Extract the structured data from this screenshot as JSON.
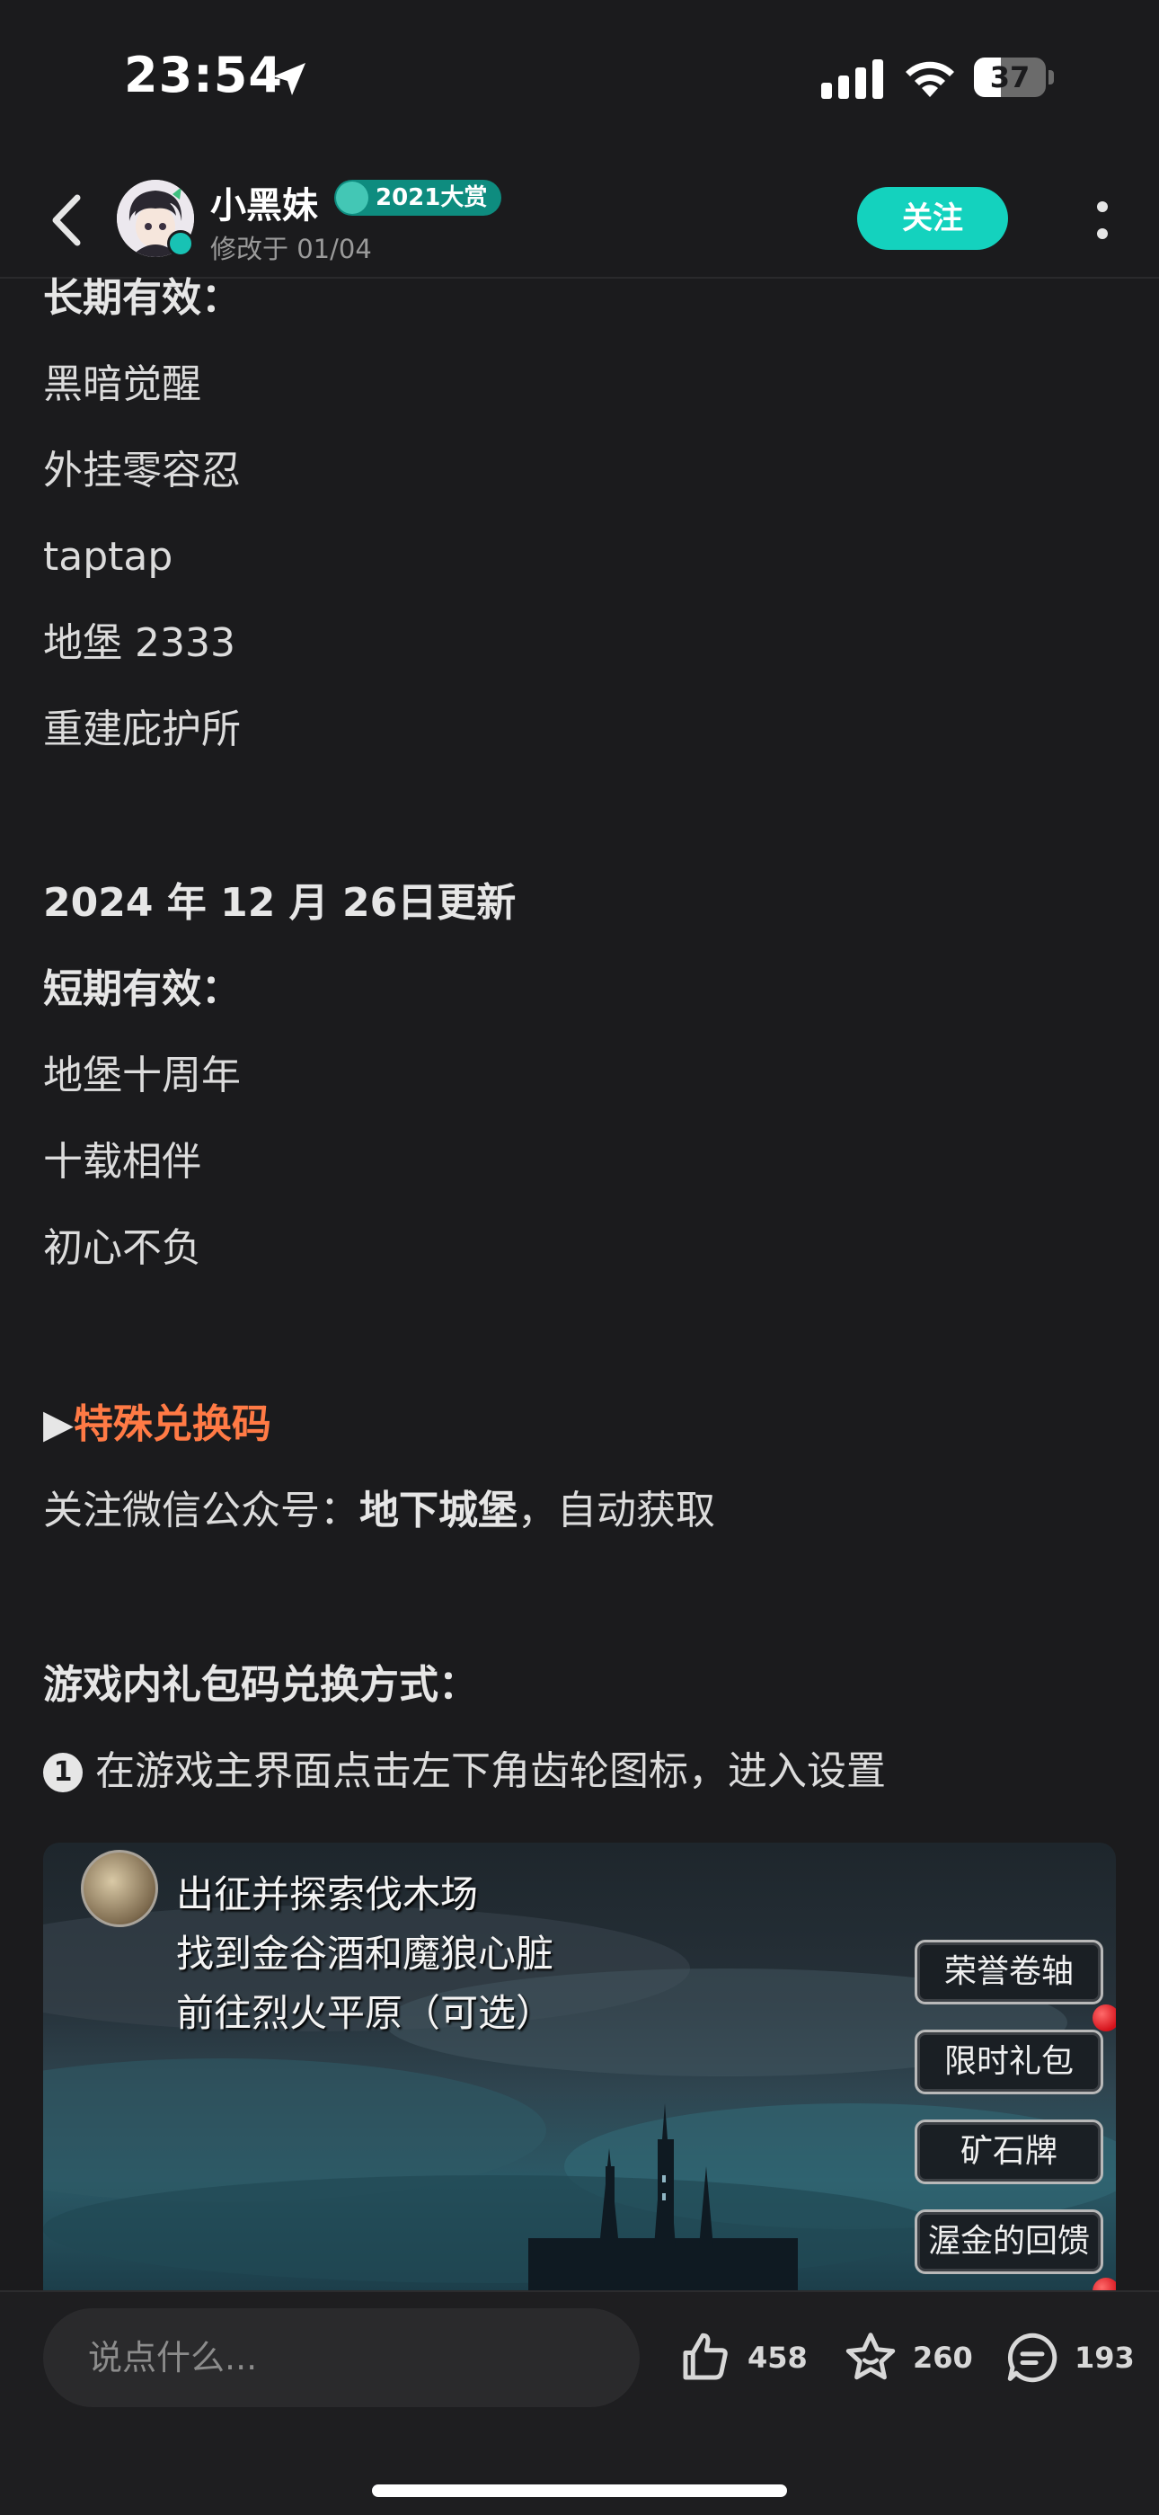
{
  "status_bar": {
    "time": "23:54",
    "battery": "37",
    "battery_level": 0.37,
    "icons": [
      "location-arrow-icon",
      "cellular-signal-icon",
      "wifi-icon",
      "battery-icon"
    ]
  },
  "header": {
    "username": "小黑妹",
    "award": "2021大赏",
    "modified": "修改于 01/04",
    "follow_label": "关注",
    "accent": "#14d2be"
  },
  "content": {
    "lines": {
      "long_term_heading": "长期有效：",
      "code_1": "黑暗觉醒",
      "code_2": "外挂零容忍",
      "code_3": "taptap",
      "code_4": "地堡 2333",
      "code_5": "重建庇护所",
      "update_date": "2024 年 12 月 26日更新",
      "short_term_heading": "短期有效：",
      "short_1": "地堡十周年",
      "short_2": "十载相伴",
      "short_3": "初心不负",
      "special_arrow": "▶",
      "special_title": "特殊兑换码",
      "wechat_prefix": "关注微信公众号：",
      "wechat_name": "地下城堡",
      "wechat_suffix": "，自动获取",
      "redeem_heading": "游戏内礼包码兑换方式：",
      "step_number": "1",
      "step_1": "在游戏主界面点击左下角齿轮图标，进入设置"
    },
    "special_color": "#ff7a45"
  },
  "game_image": {
    "quests": [
      "出征并探索伐木场",
      "找到金谷酒和魔狼心脏",
      "前往烈火平原（可选）"
    ],
    "buttons": [
      "荣誉卷轴",
      "限时礼包",
      "矿石牌",
      "渥金的回馈"
    ]
  },
  "bottom_bar": {
    "comment_placeholder": "说点什么...",
    "likes": "458",
    "favorites": "260",
    "comments": "193"
  }
}
